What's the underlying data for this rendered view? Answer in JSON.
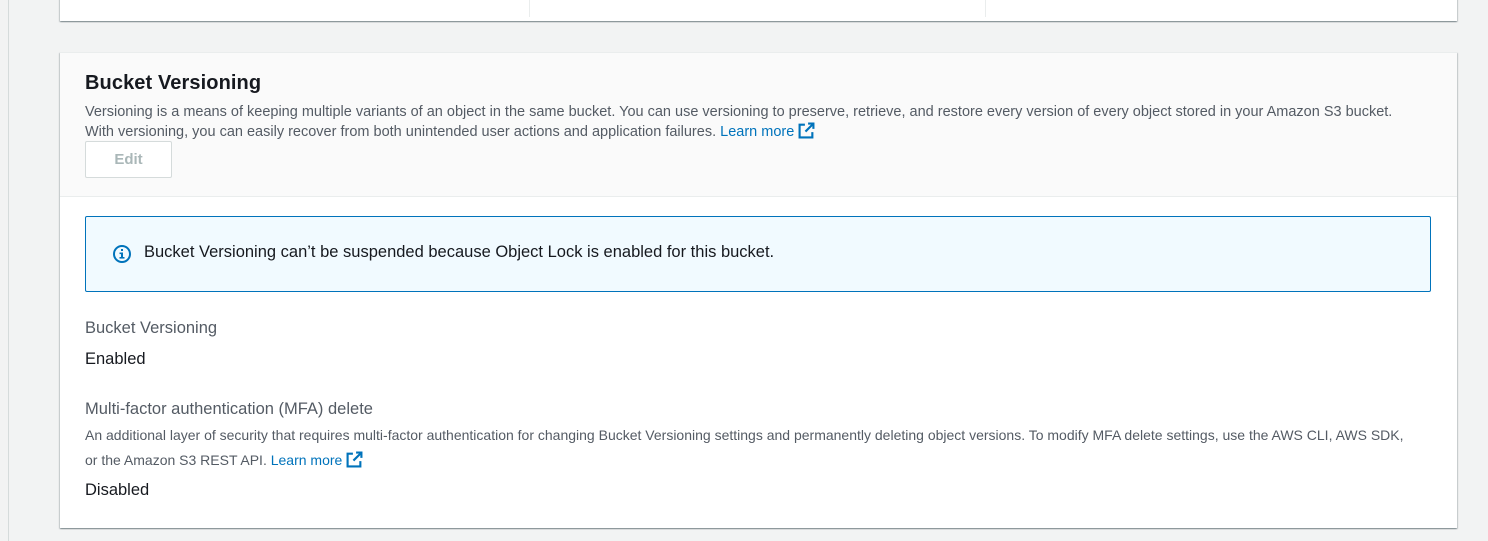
{
  "section": {
    "title": "Bucket Versioning",
    "description": "Versioning is a means of keeping multiple variants of an object in the same bucket. You can use versioning to preserve, retrieve, and restore every version of every object stored in your Amazon S3 bucket. With versioning, you can easily recover from both unintended user actions and application failures.",
    "learn_more_label": "Learn more",
    "edit_label": "Edit"
  },
  "alert": {
    "icon": "info-icon",
    "message": "Bucket Versioning can’t be suspended because Object Lock is enabled for this bucket."
  },
  "versioning": {
    "label": "Bucket Versioning",
    "value": "Enabled"
  },
  "mfa_delete": {
    "label": "Multi-factor authentication (MFA) delete",
    "description": "An additional layer of security that requires multi-factor authentication for changing Bucket Versioning settings and permanently deleting object versions. To modify MFA delete settings, use the AWS CLI, AWS SDK, or the Amazon S3 REST API.",
    "learn_more_label": "Learn more",
    "value": "Disabled"
  },
  "colors": {
    "link": "#0073bb",
    "alert_border": "#0073bb",
    "alert_bg": "#f1faff",
    "disabled_text": "#aab7b8"
  }
}
